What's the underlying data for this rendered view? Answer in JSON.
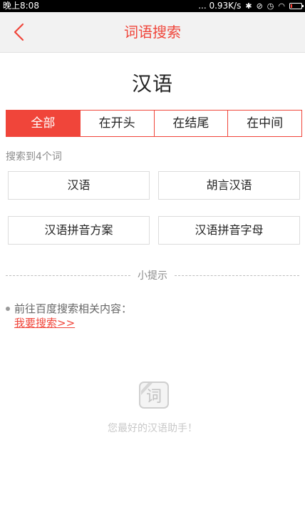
{
  "status_bar": {
    "time": "晚上8:08",
    "network_speed": "... 0.93K/s",
    "battery_level": 0.15,
    "battery_color": "#ff3b30"
  },
  "header": {
    "title": "词语搜索",
    "back_icon": "chevron-left-icon",
    "accent_color": "#f0453a"
  },
  "word": "汉语",
  "tabs": [
    {
      "label": "全部",
      "active": true
    },
    {
      "label": "在开头",
      "active": false
    },
    {
      "label": "在结尾",
      "active": false
    },
    {
      "label": "在中间",
      "active": false
    }
  ],
  "result_count_text": "搜索到4个词",
  "results": [
    {
      "label": "汉语"
    },
    {
      "label": "胡言汉语"
    },
    {
      "label": "汉语拼音方案"
    },
    {
      "label": "汉语拼音字母"
    }
  ],
  "tip": {
    "heading": "小提示",
    "text": "前往百度搜索相关内容：",
    "link": "我要搜索>>"
  },
  "footer": {
    "logo_char": "词",
    "slogan": "您最好的汉语助手！"
  }
}
